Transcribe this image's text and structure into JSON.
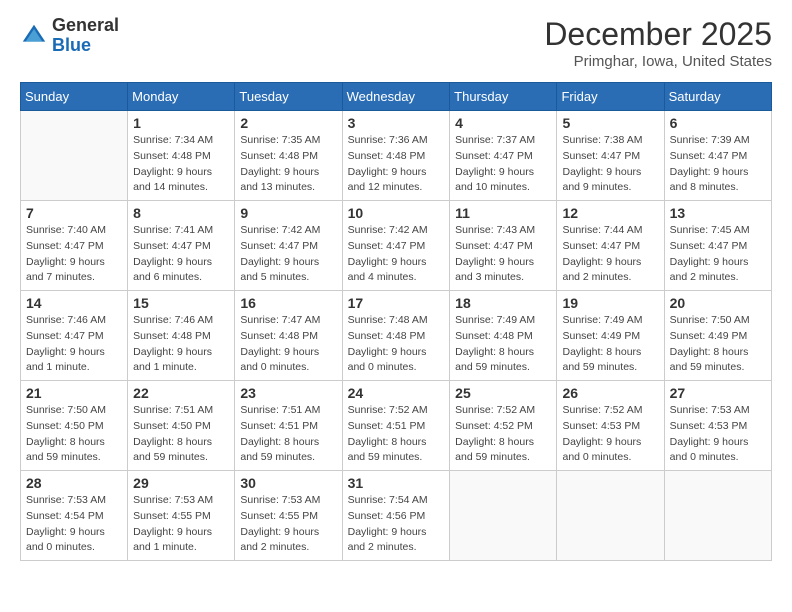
{
  "header": {
    "logo_line1": "General",
    "logo_line2": "Blue",
    "title": "December 2025",
    "subtitle": "Primghar, Iowa, United States"
  },
  "days_of_week": [
    "Sunday",
    "Monday",
    "Tuesday",
    "Wednesday",
    "Thursday",
    "Friday",
    "Saturday"
  ],
  "weeks": [
    [
      {
        "day": "",
        "sunrise": "",
        "sunset": "",
        "daylight": ""
      },
      {
        "day": "1",
        "sunrise": "Sunrise: 7:34 AM",
        "sunset": "Sunset: 4:48 PM",
        "daylight": "Daylight: 9 hours and 14 minutes."
      },
      {
        "day": "2",
        "sunrise": "Sunrise: 7:35 AM",
        "sunset": "Sunset: 4:48 PM",
        "daylight": "Daylight: 9 hours and 13 minutes."
      },
      {
        "day": "3",
        "sunrise": "Sunrise: 7:36 AM",
        "sunset": "Sunset: 4:48 PM",
        "daylight": "Daylight: 9 hours and 12 minutes."
      },
      {
        "day": "4",
        "sunrise": "Sunrise: 7:37 AM",
        "sunset": "Sunset: 4:47 PM",
        "daylight": "Daylight: 9 hours and 10 minutes."
      },
      {
        "day": "5",
        "sunrise": "Sunrise: 7:38 AM",
        "sunset": "Sunset: 4:47 PM",
        "daylight": "Daylight: 9 hours and 9 minutes."
      },
      {
        "day": "6",
        "sunrise": "Sunrise: 7:39 AM",
        "sunset": "Sunset: 4:47 PM",
        "daylight": "Daylight: 9 hours and 8 minutes."
      }
    ],
    [
      {
        "day": "7",
        "sunrise": "Sunrise: 7:40 AM",
        "sunset": "Sunset: 4:47 PM",
        "daylight": "Daylight: 9 hours and 7 minutes."
      },
      {
        "day": "8",
        "sunrise": "Sunrise: 7:41 AM",
        "sunset": "Sunset: 4:47 PM",
        "daylight": "Daylight: 9 hours and 6 minutes."
      },
      {
        "day": "9",
        "sunrise": "Sunrise: 7:42 AM",
        "sunset": "Sunset: 4:47 PM",
        "daylight": "Daylight: 9 hours and 5 minutes."
      },
      {
        "day": "10",
        "sunrise": "Sunrise: 7:42 AM",
        "sunset": "Sunset: 4:47 PM",
        "daylight": "Daylight: 9 hours and 4 minutes."
      },
      {
        "day": "11",
        "sunrise": "Sunrise: 7:43 AM",
        "sunset": "Sunset: 4:47 PM",
        "daylight": "Daylight: 9 hours and 3 minutes."
      },
      {
        "day": "12",
        "sunrise": "Sunrise: 7:44 AM",
        "sunset": "Sunset: 4:47 PM",
        "daylight": "Daylight: 9 hours and 2 minutes."
      },
      {
        "day": "13",
        "sunrise": "Sunrise: 7:45 AM",
        "sunset": "Sunset: 4:47 PM",
        "daylight": "Daylight: 9 hours and 2 minutes."
      }
    ],
    [
      {
        "day": "14",
        "sunrise": "Sunrise: 7:46 AM",
        "sunset": "Sunset: 4:47 PM",
        "daylight": "Daylight: 9 hours and 1 minute."
      },
      {
        "day": "15",
        "sunrise": "Sunrise: 7:46 AM",
        "sunset": "Sunset: 4:48 PM",
        "daylight": "Daylight: 9 hours and 1 minute."
      },
      {
        "day": "16",
        "sunrise": "Sunrise: 7:47 AM",
        "sunset": "Sunset: 4:48 PM",
        "daylight": "Daylight: 9 hours and 0 minutes."
      },
      {
        "day": "17",
        "sunrise": "Sunrise: 7:48 AM",
        "sunset": "Sunset: 4:48 PM",
        "daylight": "Daylight: 9 hours and 0 minutes."
      },
      {
        "day": "18",
        "sunrise": "Sunrise: 7:49 AM",
        "sunset": "Sunset: 4:48 PM",
        "daylight": "Daylight: 8 hours and 59 minutes."
      },
      {
        "day": "19",
        "sunrise": "Sunrise: 7:49 AM",
        "sunset": "Sunset: 4:49 PM",
        "daylight": "Daylight: 8 hours and 59 minutes."
      },
      {
        "day": "20",
        "sunrise": "Sunrise: 7:50 AM",
        "sunset": "Sunset: 4:49 PM",
        "daylight": "Daylight: 8 hours and 59 minutes."
      }
    ],
    [
      {
        "day": "21",
        "sunrise": "Sunrise: 7:50 AM",
        "sunset": "Sunset: 4:50 PM",
        "daylight": "Daylight: 8 hours and 59 minutes."
      },
      {
        "day": "22",
        "sunrise": "Sunrise: 7:51 AM",
        "sunset": "Sunset: 4:50 PM",
        "daylight": "Daylight: 8 hours and 59 minutes."
      },
      {
        "day": "23",
        "sunrise": "Sunrise: 7:51 AM",
        "sunset": "Sunset: 4:51 PM",
        "daylight": "Daylight: 8 hours and 59 minutes."
      },
      {
        "day": "24",
        "sunrise": "Sunrise: 7:52 AM",
        "sunset": "Sunset: 4:51 PM",
        "daylight": "Daylight: 8 hours and 59 minutes."
      },
      {
        "day": "25",
        "sunrise": "Sunrise: 7:52 AM",
        "sunset": "Sunset: 4:52 PM",
        "daylight": "Daylight: 8 hours and 59 minutes."
      },
      {
        "day": "26",
        "sunrise": "Sunrise: 7:52 AM",
        "sunset": "Sunset: 4:53 PM",
        "daylight": "Daylight: 9 hours and 0 minutes."
      },
      {
        "day": "27",
        "sunrise": "Sunrise: 7:53 AM",
        "sunset": "Sunset: 4:53 PM",
        "daylight": "Daylight: 9 hours and 0 minutes."
      }
    ],
    [
      {
        "day": "28",
        "sunrise": "Sunrise: 7:53 AM",
        "sunset": "Sunset: 4:54 PM",
        "daylight": "Daylight: 9 hours and 0 minutes."
      },
      {
        "day": "29",
        "sunrise": "Sunrise: 7:53 AM",
        "sunset": "Sunset: 4:55 PM",
        "daylight": "Daylight: 9 hours and 1 minute."
      },
      {
        "day": "30",
        "sunrise": "Sunrise: 7:53 AM",
        "sunset": "Sunset: 4:55 PM",
        "daylight": "Daylight: 9 hours and 2 minutes."
      },
      {
        "day": "31",
        "sunrise": "Sunrise: 7:54 AM",
        "sunset": "Sunset: 4:56 PM",
        "daylight": "Daylight: 9 hours and 2 minutes."
      },
      {
        "day": "",
        "sunrise": "",
        "sunset": "",
        "daylight": ""
      },
      {
        "day": "",
        "sunrise": "",
        "sunset": "",
        "daylight": ""
      },
      {
        "day": "",
        "sunrise": "",
        "sunset": "",
        "daylight": ""
      }
    ]
  ]
}
